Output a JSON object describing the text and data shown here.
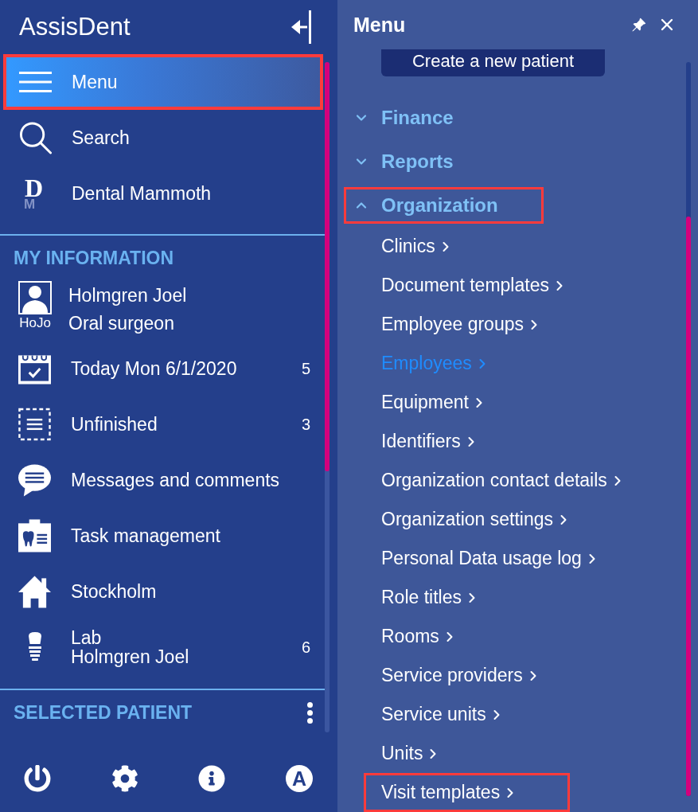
{
  "app": {
    "title": "AssisDent"
  },
  "nav": [
    {
      "kind": "menu",
      "label": "Menu",
      "selected": true,
      "highlighted": true
    },
    {
      "kind": "search",
      "label": "Search",
      "selected": false,
      "highlighted": false
    },
    {
      "kind": "logo",
      "label": "Dental Mammoth",
      "logo": {
        "front": "D",
        "back": "M"
      },
      "selected": false,
      "highlighted": false
    }
  ],
  "my_information": {
    "heading": "MY INFORMATION",
    "user": {
      "name": "Holmgren Joel",
      "role": "Oral surgeon",
      "initials": "HoJo"
    },
    "items": [
      {
        "kind": "today",
        "label": "Today Mon 6/1/2020",
        "count": "5"
      },
      {
        "kind": "unfinished",
        "label": "Unfinished",
        "count": "3"
      },
      {
        "kind": "messages",
        "label": "Messages and comments"
      },
      {
        "kind": "tasks",
        "label": "Task management"
      },
      {
        "kind": "clinic",
        "label": "Stockholm"
      },
      {
        "kind": "lab",
        "label": "Lab",
        "sublabel": "Holmgren Joel",
        "count": "6"
      }
    ]
  },
  "selected_patient": {
    "heading": "SELECTED PATIENT"
  },
  "toolbar": {
    "profile_initial": "A"
  },
  "menu_panel": {
    "title": "Menu",
    "create_button": "Create a new patient",
    "sections": [
      {
        "label": "Finance",
        "expanded": false,
        "highlighted": false
      },
      {
        "label": "Reports",
        "expanded": false,
        "highlighted": false
      },
      {
        "label": "Organization",
        "expanded": true,
        "highlighted": true,
        "children": [
          {
            "label": "Clinics",
            "selected": false,
            "highlighted": false
          },
          {
            "label": "Document templates",
            "selected": false,
            "highlighted": false
          },
          {
            "label": "Employee groups",
            "selected": false,
            "highlighted": false
          },
          {
            "label": "Employees",
            "selected": true,
            "highlighted": false
          },
          {
            "label": "Equipment",
            "selected": false,
            "highlighted": false
          },
          {
            "label": "Identifiers",
            "selected": false,
            "highlighted": false
          },
          {
            "label": "Organization contact details",
            "selected": false,
            "highlighted": false
          },
          {
            "label": "Organization settings",
            "selected": false,
            "highlighted": false
          },
          {
            "label": "Personal Data usage log",
            "selected": false,
            "highlighted": false
          },
          {
            "label": "Role titles",
            "selected": false,
            "highlighted": false
          },
          {
            "label": "Rooms",
            "selected": false,
            "highlighted": false
          },
          {
            "label": "Service providers",
            "selected": false,
            "highlighted": false
          },
          {
            "label": "Service units",
            "selected": false,
            "highlighted": false
          },
          {
            "label": "Units",
            "selected": false,
            "highlighted": false
          },
          {
            "label": "Visit templates",
            "selected": false,
            "highlighted": true
          }
        ]
      }
    ]
  }
}
